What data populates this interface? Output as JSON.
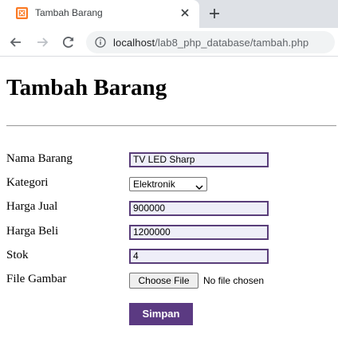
{
  "browser": {
    "tab_title": "Tambah Barang",
    "url_host": "localhost",
    "url_path": "/lab8_php_database/tambah.php"
  },
  "page": {
    "title": "Tambah Barang"
  },
  "form": {
    "nama_label": "Nama Barang",
    "nama_value": "TV LED Sharp",
    "kategori_label": "Kategori",
    "kategori_selected": "Elektronik",
    "harga_jual_label": "Harga Jual",
    "harga_jual_value": "900000",
    "harga_beli_label": "Harga Beli",
    "harga_beli_value": "1200000",
    "stok_label": "Stok",
    "stok_value": "4",
    "file_label": "File Gambar",
    "file_button": "Choose File",
    "file_status": "No file chosen",
    "submit_label": "Simpan"
  },
  "colors": {
    "accent": "#5b3a82",
    "input_border": "#5a3e7a",
    "input_bg": "#eeeef8",
    "favicon": "#fb7a24"
  },
  "icons": [
    "xampp-favicon-icon",
    "close-icon",
    "plus-icon",
    "back-arrow-icon",
    "forward-arrow-icon",
    "reload-icon",
    "info-icon",
    "chevron-down-icon"
  ]
}
